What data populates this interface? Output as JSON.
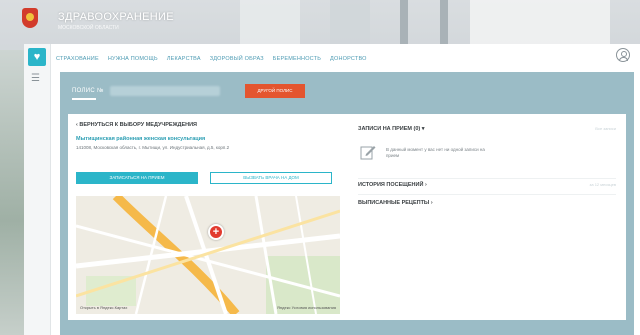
{
  "header": {
    "title": "ЗДРАВООХРАНЕНИЕ",
    "subtitle": "МОСКОВСКОЙ ОБЛАСТИ"
  },
  "nav": {
    "items": [
      {
        "label": "СТРАХОВАНИЕ"
      },
      {
        "label": "НУЖНА ПОМОЩЬ"
      },
      {
        "label": "ЛЕКАРСТВА"
      },
      {
        "label": "ЗДОРОВЫЙ ОБРАЗ"
      },
      {
        "label": "БЕРЕМЕННОСТЬ"
      },
      {
        "label": "ДОНОРСТВО"
      }
    ]
  },
  "polis": {
    "label": "ПОЛИС №",
    "other_button": "ДРУГОЙ ПОЛИС"
  },
  "clinic": {
    "back_link": "‹ ВЕРНУТЬСЯ К ВЫБОРУ МЕДУЧРЕЖДЕНИЯ",
    "name": "Мытищинская районная женская консультация",
    "address": "141008, Московская область, г. Мытищи, ул. Индустриальная, д.5, корп.2",
    "sign_up_button": "ЗАПИСАТЬСЯ НА ПРИЕМ",
    "call_doctor_button": "ВЫЗВАТЬ ВРАЧА НА ДОМ"
  },
  "map": {
    "attribution_left": "Открыть в Яндекс.Картах",
    "attribution_right": "Яндекс  Условия использования"
  },
  "records": {
    "title": "ЗАПИСИ НА ПРИЕМ (0) ▾",
    "link": "Все записи",
    "empty_text": "В данный момент у вас нет ни одной записи на прием"
  },
  "history": {
    "title": "ИСТОРИЯ ПОСЕЩЕНИЙ ›",
    "link": "за 12 месяцев"
  },
  "recipes": {
    "title": "ВЫПИСАННЫЕ РЕЦЕПТЫ ›"
  },
  "icons": {
    "heart": "♥",
    "menu": "☰",
    "cross": "+"
  },
  "colors": {
    "accent": "#2bb5c9",
    "alert": "#e4552f",
    "panel": "#9bbcc6"
  }
}
